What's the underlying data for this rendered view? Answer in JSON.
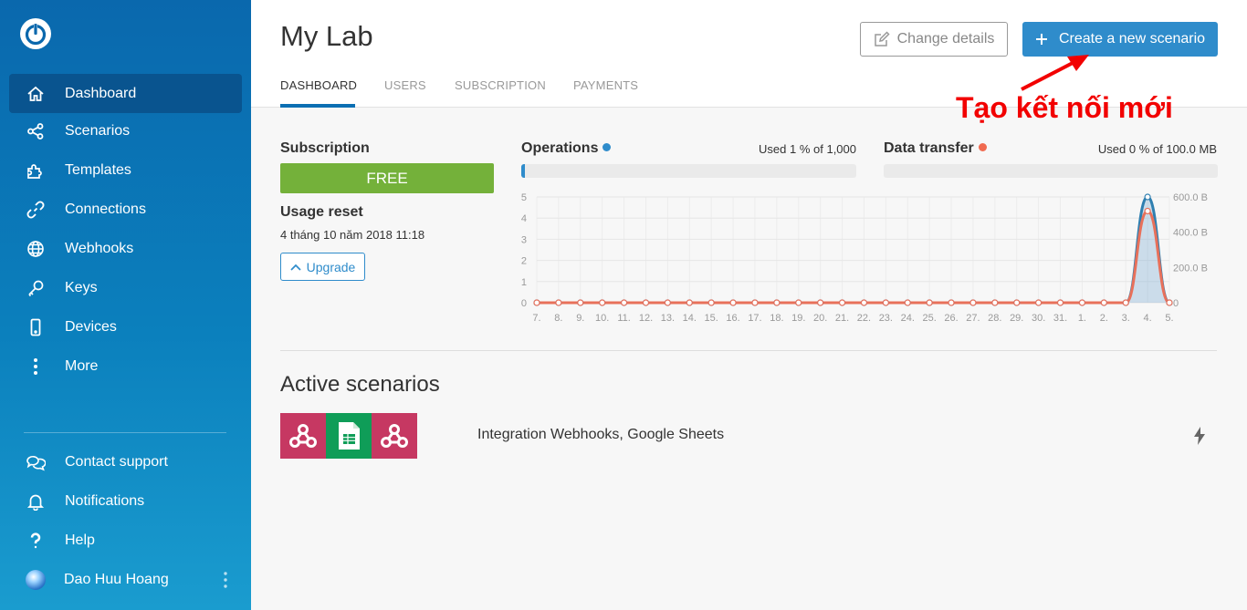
{
  "app": {
    "logo_icon": "power-icon"
  },
  "sidebar": {
    "items": [
      {
        "label": "Dashboard",
        "icon": "home-icon",
        "active": true
      },
      {
        "label": "Scenarios",
        "icon": "share-icon"
      },
      {
        "label": "Templates",
        "icon": "puzzle-icon"
      },
      {
        "label": "Connections",
        "icon": "link-icon"
      },
      {
        "label": "Webhooks",
        "icon": "globe-icon"
      },
      {
        "label": "Keys",
        "icon": "key-icon"
      },
      {
        "label": "Devices",
        "icon": "mobile-icon"
      },
      {
        "label": "More",
        "icon": "more-dots-icon"
      }
    ],
    "bottom_items": [
      {
        "label": "Contact support",
        "icon": "chat-icon"
      },
      {
        "label": "Notifications",
        "icon": "bell-icon"
      },
      {
        "label": "Help",
        "icon": "question-icon"
      }
    ],
    "user": {
      "name": "Dao Huu Hoang"
    }
  },
  "header": {
    "title": "My Lab",
    "change_details_label": "Change details",
    "create_label": "Create a new scenario",
    "tabs": [
      "DASHBOARD",
      "USERS",
      "SUBSCRIPTION",
      "PAYMENTS"
    ],
    "active_tab": "DASHBOARD"
  },
  "annotation": {
    "text": "Tạo kết nối mới",
    "color": "#f20000"
  },
  "subscription": {
    "label": "Subscription",
    "plan": "FREE",
    "plan_color": "#74b13a",
    "usage_reset_label": "Usage reset",
    "usage_reset_date": "4 tháng 10 năm 2018 11:18",
    "upgrade_label": "Upgrade"
  },
  "operations": {
    "label": "Operations",
    "used_text": "Used 1 % of 1,000",
    "used_fraction": 0.01,
    "color": "#2f8ccb"
  },
  "data_transfer": {
    "label": "Data transfer",
    "used_text": "Used 0 % of 100.0 MB",
    "used_fraction": 0.0,
    "color": "#f06a50"
  },
  "chart_data": {
    "type": "area",
    "title": "",
    "xlabel": "",
    "ylabel": "",
    "x": [
      "7.",
      "8.",
      "9.",
      "10.",
      "11.",
      "12.",
      "13.",
      "14.",
      "15.",
      "16.",
      "17.",
      "18.",
      "19.",
      "20.",
      "21.",
      "22.",
      "23.",
      "24.",
      "25.",
      "26.",
      "27.",
      "28.",
      "29.",
      "30.",
      "31.",
      "1.",
      "2.",
      "3.",
      "4.",
      "5."
    ],
    "y_left_ticks": [
      "0",
      "1",
      "2",
      "3",
      "4",
      "5"
    ],
    "y_left_lim": [
      0,
      5
    ],
    "y_right_ticks": [
      "0",
      "200.0 B",
      "400.0 B",
      "600.0 B"
    ],
    "y_right_lim": [
      0,
      600
    ],
    "grid": true,
    "series": [
      {
        "axis": "left",
        "color": "#2f7fb0",
        "values": [
          0,
          0,
          0,
          0,
          0,
          0,
          0,
          0,
          0,
          0,
          0,
          0,
          0,
          0,
          0,
          0,
          0,
          0,
          0,
          0,
          0,
          0,
          0,
          0,
          0,
          0,
          0,
          0,
          5,
          0
        ]
      },
      {
        "axis": "right",
        "color": "#e8705a",
        "values": [
          0,
          0,
          0,
          0,
          0,
          0,
          0,
          0,
          0,
          0,
          0,
          0,
          0,
          0,
          0,
          0,
          0,
          0,
          0,
          0,
          0,
          0,
          0,
          0,
          0,
          0,
          0,
          0,
          520,
          0
        ]
      }
    ]
  },
  "active_scenarios": {
    "title": "Active scenarios",
    "items": [
      {
        "name": "Integration Webhooks, Google Sheets",
        "apps": [
          {
            "icon": "webhook-icon",
            "color": "#c63862"
          },
          {
            "icon": "google-sheets-icon",
            "color": "#0f9d58"
          },
          {
            "icon": "webhook-icon",
            "color": "#c63862"
          }
        ]
      }
    ]
  }
}
